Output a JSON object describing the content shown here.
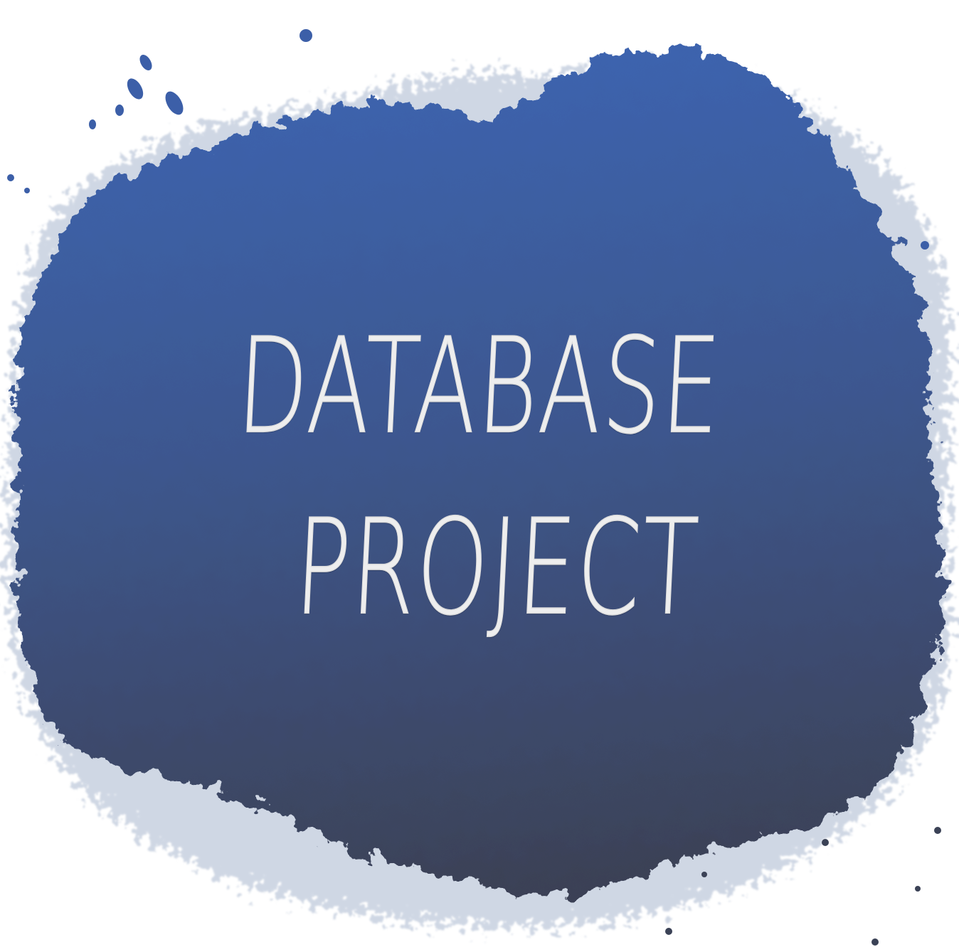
{
  "title": {
    "line1": "DATABASE",
    "line2": "PROJECT"
  },
  "colors": {
    "splash_top": "#3c62ad",
    "splash_bottom": "#3c4256",
    "spray": "#9fb0cc",
    "text": "#eeeeee",
    "background": "#ffffff"
  }
}
